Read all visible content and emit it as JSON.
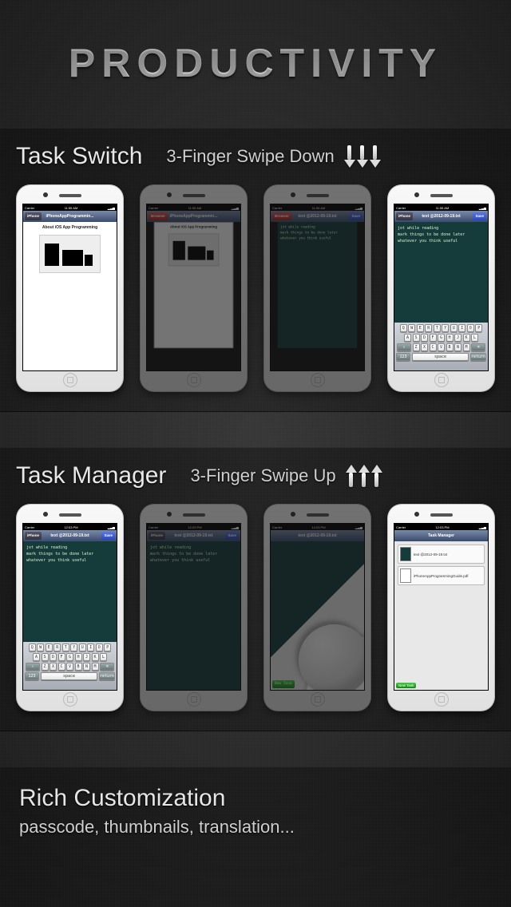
{
  "title": "Productivity",
  "task_switch": {
    "title": "Task Switch",
    "gesture": "3-Finger Swipe Down",
    "arrow_dir": "down",
    "doc_title": "iPhoneAppProgrammin...",
    "doc_heading": "About iOS App Programming",
    "editor_title": "text @2012-09-19.txt",
    "editor_lines": [
      "jot while reading",
      "mark things to be done later",
      "whatever you think useful"
    ],
    "status_time": "11:55 AM",
    "carrier": "Carrier",
    "save_label": "Save",
    "back_label": "iPhone",
    "close_label": "Browser"
  },
  "task_manager": {
    "title": "Task Manager",
    "gesture": "3-Finger Swipe Up",
    "arrow_dir": "up",
    "status_time": "12:03 PM",
    "editor_title": "text @2012-09-19.txt",
    "editor_lines": [
      "jot while reading",
      "mark things to be done later",
      "whatever you think useful"
    ],
    "mgr_title": "Task Manager",
    "tasks": [
      "text @2012-09-19.txt",
      "iPhoneAppProgrammingGuide.pdf"
    ],
    "new_task_label": "New Task"
  },
  "customization": {
    "title": "Rich Customization",
    "subtitle": "passcode, thumbnails, translation..."
  },
  "keyboard": {
    "row1": [
      "Q",
      "W",
      "E",
      "R",
      "T",
      "Y",
      "U",
      "I",
      "O",
      "P"
    ],
    "row2": [
      "A",
      "S",
      "D",
      "F",
      "G",
      "H",
      "J",
      "K",
      "L"
    ],
    "row3": [
      "⇧",
      "Z",
      "X",
      "C",
      "V",
      "B",
      "N",
      "M",
      "⌫"
    ],
    "row4": [
      "123",
      "space",
      "return"
    ]
  }
}
